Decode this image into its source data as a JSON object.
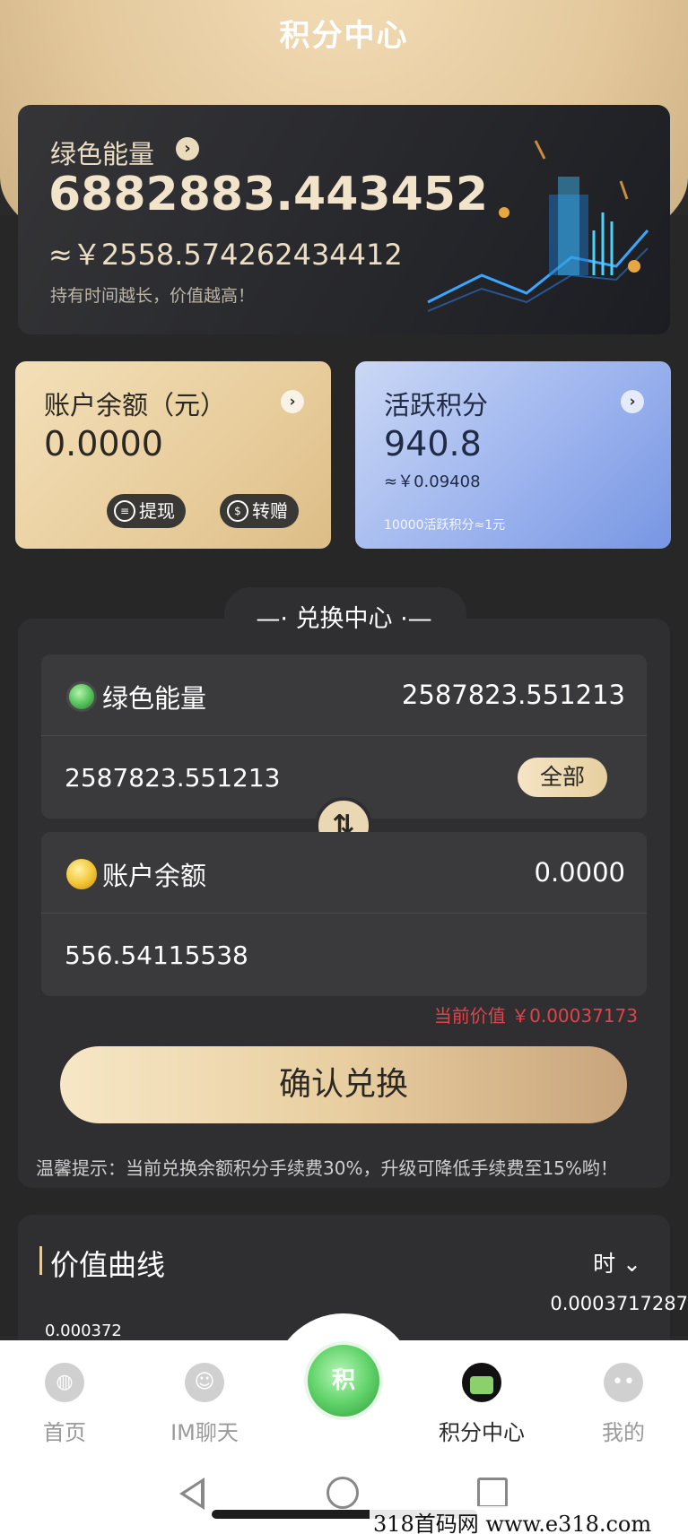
{
  "header": {
    "title": "积分中心"
  },
  "energy_card": {
    "title": "绿色能量",
    "value": "6882883.443452",
    "cny_value": "≈￥2558.574262434412",
    "note": "持有时间越长，价值越高！"
  },
  "balance_card": {
    "title": "账户余额（元）",
    "value": "0.0000",
    "withdraw_label": "提现",
    "gift_label": "转赠"
  },
  "active_card": {
    "title": "活跃积分",
    "value": "940.8",
    "cny_value": "≈￥0.09408",
    "note": "10000活跃积分≈1元"
  },
  "exchange": {
    "title": "兑换中心",
    "from": {
      "label": "绿色能量",
      "available": "2587823.551213",
      "input_value": "2587823.551213",
      "all_label": "全部"
    },
    "to": {
      "label": "账户余额",
      "available": "0.0000",
      "input_value": "556.54115538"
    },
    "current_price": "当前价值 ￥0.00037173",
    "confirm_label": "确认兑换",
    "tip": "温馨提示：当前兑换余额积分手续费30%，升级可降低手续费至15%哟！"
  },
  "value_chart": {
    "title": "价值曲线",
    "period": "时",
    "y_max_label": "0.000372",
    "latest_value": "0.0003717287"
  },
  "bottom_nav": {
    "items": [
      {
        "label": "首页",
        "icon": "planet-icon"
      },
      {
        "label": "IM聊天",
        "icon": "chat-icon"
      },
      {
        "label": "积",
        "icon": "points-center-icon"
      },
      {
        "label": "积分中心",
        "icon": "points-icon"
      },
      {
        "label": "我的",
        "icon": "profile-icon"
      }
    ]
  },
  "watermark": "318首码网 www.e318.com",
  "colors": {
    "gold": "#e8cd9c",
    "blue_card": "#9db4ee",
    "accent_red": "#e2434b",
    "green": "#62d46b"
  }
}
